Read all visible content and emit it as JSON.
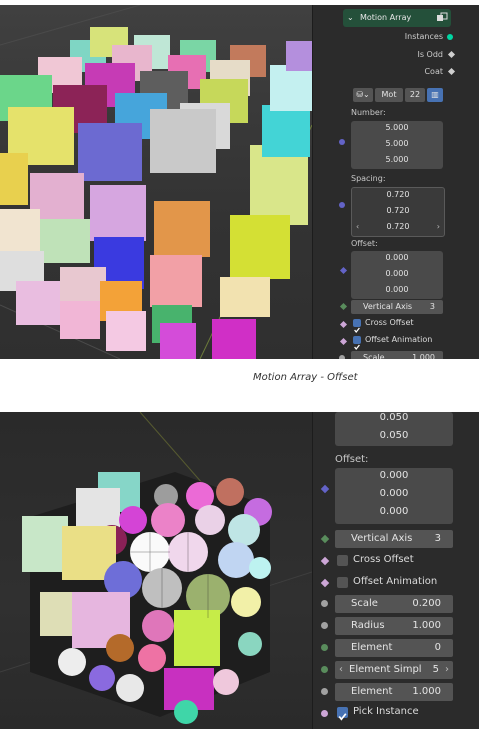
{
  "caption": "Motion Array - Offset",
  "panel1": {
    "header_title": "Motion Array",
    "outputs": [
      "Instances",
      "Is Odd",
      "Coat"
    ],
    "selector": {
      "name": "Mot",
      "users": "22"
    },
    "number_label": "Number:",
    "number_values": [
      "5.000",
      "5.000",
      "5.000"
    ],
    "spacing_label": "Spacing:",
    "spacing_values": [
      "0.720",
      "0.720",
      "0.720"
    ],
    "offset_label": "Offset:",
    "offset_values": [
      "0.000",
      "0.000",
      "0.000"
    ],
    "vertical_axis": {
      "label": "Vertical Axis",
      "value": "3"
    },
    "cross_offset": {
      "label": "Cross Offset",
      "checked": true
    },
    "offset_animation": {
      "label": "Offset Animation",
      "checked": true
    },
    "scale": {
      "label": "Scale",
      "value": "1.000"
    }
  },
  "panel2": {
    "top_values": [
      "0.050",
      "0.050"
    ],
    "offset_label": "Offset:",
    "offset_values": [
      "0.000",
      "0.000",
      "0.000"
    ],
    "vertical_axis": {
      "label": "Vertical Axis",
      "value": "3"
    },
    "cross_offset": {
      "label": "Cross Offset",
      "checked": false
    },
    "offset_animation": {
      "label": "Offset Animation",
      "checked": false
    },
    "scale": {
      "label": "Scale",
      "value": "0.200"
    },
    "radius": {
      "label": "Radius",
      "value": "1.000"
    },
    "element": {
      "label": "Element",
      "value": "0"
    },
    "element_simple": {
      "label": "Element Simpl",
      "value": "5"
    },
    "element2": {
      "label": "Element",
      "value": "1.000"
    },
    "pick_instance": {
      "label": "Pick Instance",
      "checked": true
    }
  },
  "colors": {
    "checkbox_on": "#4772b3",
    "socket_float": "#a1a1a1",
    "socket_vector": "#6363c7",
    "socket_int": "#598c5c",
    "socket_bool": "#cca6d6",
    "socket_geometry": "#00d6a3",
    "node_header": "#24503a"
  }
}
